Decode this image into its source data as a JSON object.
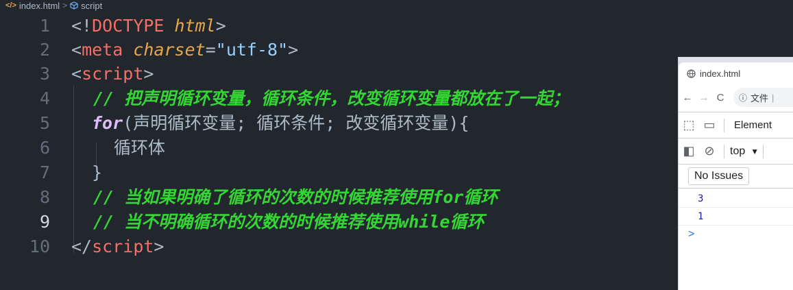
{
  "breadcrumb": {
    "file": "index.html",
    "separator": ">",
    "symbol": "script"
  },
  "editor": {
    "lines": [
      {
        "num": "1"
      },
      {
        "num": "2"
      },
      {
        "num": "3"
      },
      {
        "num": "4"
      },
      {
        "num": "5"
      },
      {
        "num": "6"
      },
      {
        "num": "7"
      },
      {
        "num": "8"
      },
      {
        "num": "9"
      },
      {
        "num": "10"
      }
    ],
    "active_line": "9",
    "tokens": {
      "l1_open": "<!",
      "l1_tag": "DOCTYPE",
      "l1_attr": "html",
      "l1_close": ">",
      "l2_open": "<",
      "l2_tag": "meta",
      "l2_attr": "charset",
      "l2_eq": "=",
      "l2_str": "\"utf-8\"",
      "l2_close": ">",
      "l3_open": "<",
      "l3_tag": "script",
      "l3_close": ">",
      "l4_comment": "// 把声明循环变量，循环条件，改变循环变量都放在了一起；",
      "l5_kw": "for",
      "l5_rest": "(声明循环变量; 循环条件; 改变循环变量){",
      "l6_text": "循环体",
      "l7_text": "}",
      "l8_comment": "// 当如果明确了循环的次数的时候推荐使用for循环",
      "l9_comment": "// 当不明确循环的次数的时候推荐使用while循环",
      "l10_open": "</",
      "l10_tag": "script",
      "l10_close": ">"
    }
  },
  "browser": {
    "tab_title": "index.html",
    "omnibox_label": "文件",
    "devtools": {
      "elements_tab": "Element",
      "context": "top",
      "issues_button": "No Issues",
      "console_output": [
        "3",
        "1"
      ],
      "prompt": ">"
    }
  }
}
